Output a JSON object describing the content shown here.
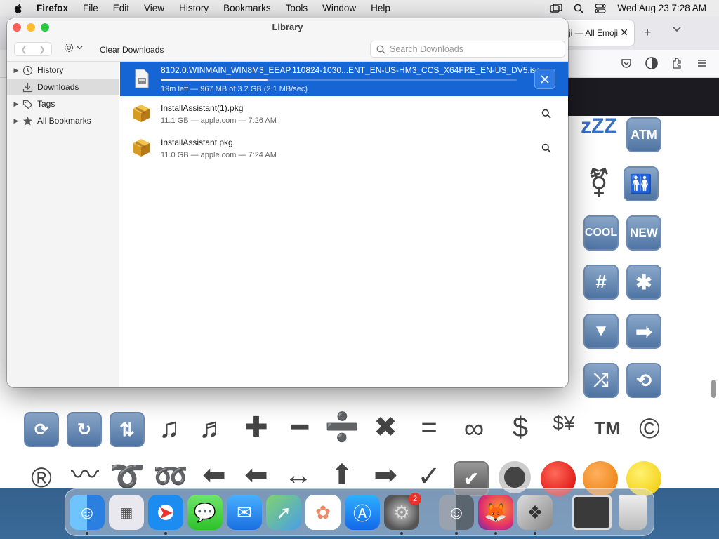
{
  "menubar": {
    "app": "Firefox",
    "items": [
      "File",
      "Edit",
      "View",
      "History",
      "Bookmarks",
      "Tools",
      "Window",
      "Help"
    ],
    "clock": "Wed Aug 23  7:28 AM"
  },
  "firefox": {
    "tab_title": "ji — All Emoji"
  },
  "library": {
    "title": "Library",
    "clear_label": "Clear Downloads",
    "search_placeholder": "Search Downloads",
    "sidebar": [
      {
        "label": "History",
        "icon": "clock-icon"
      },
      {
        "label": "Downloads",
        "icon": "download-icon"
      },
      {
        "label": "Tags",
        "icon": "tag-icon"
      },
      {
        "label": "All Bookmarks",
        "icon": "star-icon"
      }
    ],
    "downloads": [
      {
        "name": "8102.0.WINMAIN_WIN8M3_EEAP.110824-1030...ENT_EN-US-HM3_CCS_X64FRE_EN-US_DV5.iso",
        "meta": "19m left — 967 MB of 3.2 GB (2.1 MB/sec)",
        "progress": 0.3,
        "icon": "disk-image-icon"
      },
      {
        "name": "InstallAssistant(1).pkg",
        "meta": "11.1 GB — apple.com — 7:26 AM",
        "icon": "package-icon"
      },
      {
        "name": "InstallAssistant.pkg",
        "meta": "11.0 GB — apple.com — 7:24 AM",
        "icon": "package-icon"
      }
    ]
  },
  "emoji_labels": {
    "atm": "ATM",
    "cool": "COOL",
    "new": "NEW",
    "tm": "TM"
  },
  "dock": {
    "badge": "2"
  }
}
